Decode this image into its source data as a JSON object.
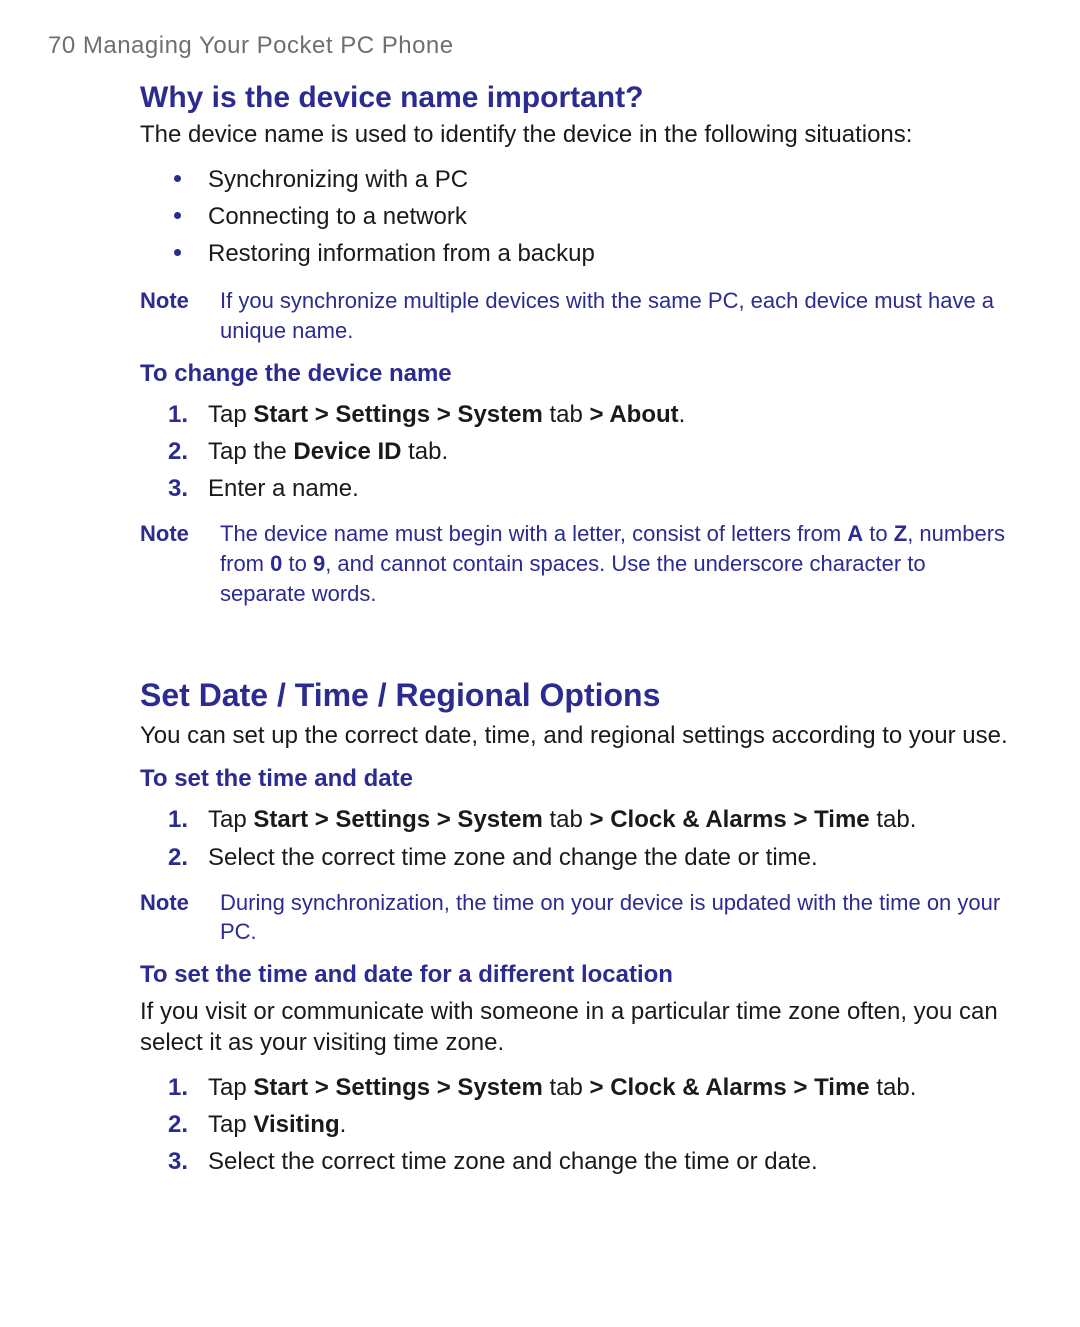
{
  "running_head": "70  Managing Your Pocket PC Phone",
  "noteLabel": "Note",
  "section1": {
    "heading": "Why is the device name important?",
    "intro": "The device name is used to identify the device in the following situations:",
    "bullets": [
      "Synchronizing with a PC",
      "Connecting to a network",
      "Restoring information from a backup"
    ],
    "note1": "If you synchronize multiple devices with the same PC, each device must have a unique name.",
    "subheading": "To change the device name",
    "step1": {
      "pre": "Tap ",
      "bold1": "Start > Settings > System",
      "mid": " tab ",
      "bold2": "> About",
      "post": "."
    },
    "step2": {
      "pre": "Tap the ",
      "bold": "Device ID",
      "post": " tab."
    },
    "step3": "Enter a name.",
    "note2": {
      "t1": "The device name must begin with a letter, consist of letters from ",
      "b1": "A",
      "t2": " to ",
      "b2": "Z",
      "t3": ", numbers from ",
      "b3": "0",
      "t4": " to ",
      "b4": "9",
      "t5": ", and cannot contain spaces. Use the underscore character to separate words."
    }
  },
  "section2": {
    "heading": "Set Date / Time / Regional Options",
    "intro": "You can set up the correct date, time, and regional settings according to your use.",
    "sub1": {
      "heading": "To set the time and date",
      "step1": {
        "pre": "Tap ",
        "bold1": "Start > Settings > System",
        "mid": " tab ",
        "bold2": "> Clock & Alarms > Time",
        "post": " tab."
      },
      "step2": "Select the correct time zone and change the date or time."
    },
    "note": "During synchronization, the time on your device is updated with the time on your PC.",
    "sub2": {
      "heading": "To set the time and date for a different location",
      "intro": "If you visit or communicate with someone in a particular time zone often, you can select it as your visiting time zone.",
      "step1": {
        "pre": "Tap ",
        "bold1": "Start > Settings > System",
        "mid": " tab ",
        "bold2": "> Clock & Alarms > Time",
        "post": " tab."
      },
      "step2": {
        "pre": "Tap ",
        "bold": "Visiting",
        "post": "."
      },
      "step3": "Select the correct time zone and change the time or date."
    }
  }
}
